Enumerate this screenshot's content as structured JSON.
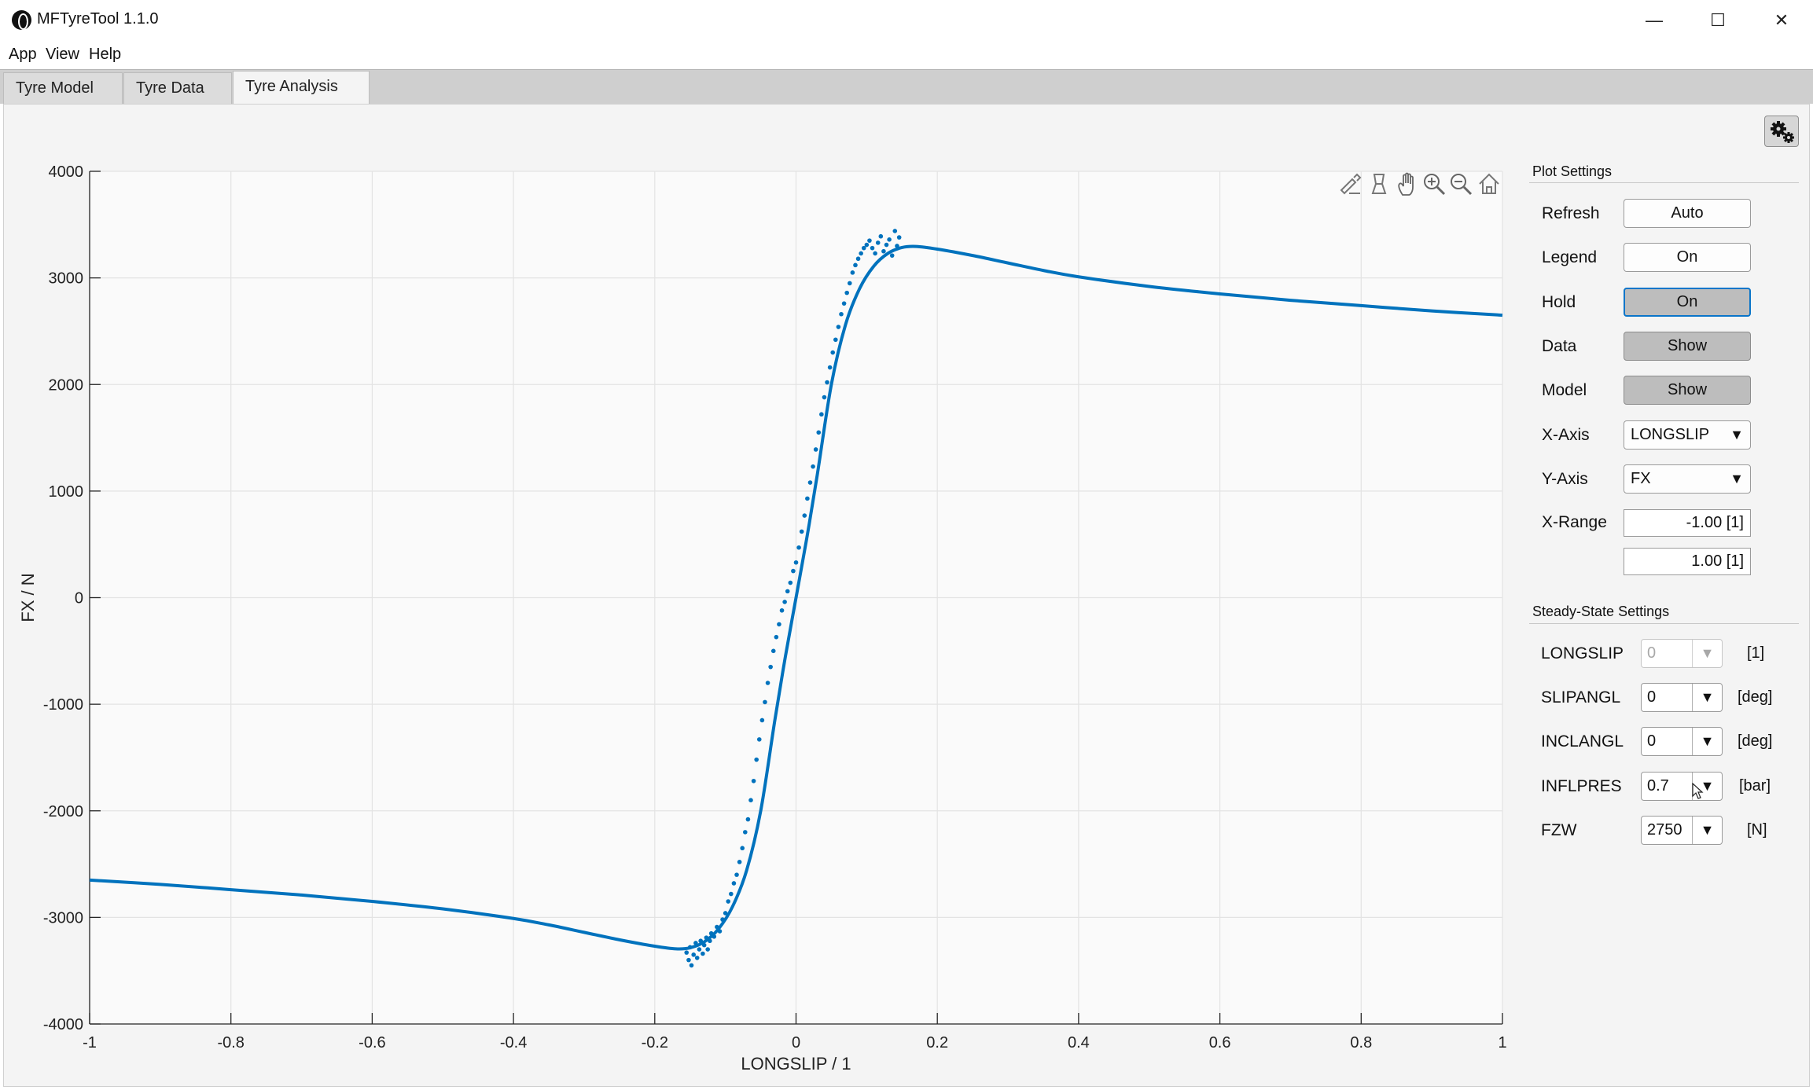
{
  "window": {
    "title": "MFTyreTool 1.1.0",
    "controls": {
      "minimize": "—",
      "maximize": "☐",
      "close": "✕"
    }
  },
  "menu": [
    "App",
    "View",
    "Help"
  ],
  "tabs": [
    {
      "label": "Tyre Model",
      "active": false
    },
    {
      "label": "Tyre Data",
      "active": false
    },
    {
      "label": "Tyre Analysis",
      "active": true
    }
  ],
  "plot_toolbar": [
    "brush-icon",
    "data-tips-icon",
    "pan-icon",
    "zoom-in-icon",
    "zoom-out-icon",
    "home-icon"
  ],
  "plot_settings": {
    "title": "Plot Settings",
    "refresh": {
      "label": "Refresh",
      "value": "Auto"
    },
    "legend": {
      "label": "Legend",
      "value": "On"
    },
    "hold": {
      "label": "Hold",
      "value": "On"
    },
    "data": {
      "label": "Data",
      "value": "Show"
    },
    "model": {
      "label": "Model",
      "value": "Show"
    },
    "x_axis": {
      "label": "X-Axis",
      "value": "LONGSLIP"
    },
    "y_axis": {
      "label": "Y-Axis",
      "value": "FX"
    },
    "x_range": {
      "label": "X-Range",
      "min": "-1.00 [1]",
      "max": "1.00 [1]"
    }
  },
  "steady_state": {
    "title": "Steady-State Settings",
    "rows": [
      {
        "label": "LONGSLIP",
        "value": "0",
        "unit": "[1]",
        "disabled": true
      },
      {
        "label": "SLIPANGL",
        "value": "0",
        "unit": "[deg]",
        "disabled": false
      },
      {
        "label": "INCLANGL",
        "value": "0",
        "unit": "[deg]",
        "disabled": false
      },
      {
        "label": "INFLPRES",
        "value": "0.7",
        "unit": "[bar]",
        "disabled": false
      },
      {
        "label": "FZW",
        "value": "2750",
        "unit": "[N]",
        "disabled": false
      }
    ]
  },
  "colors": {
    "series": "#0072bd",
    "grid": "#e3e3e3",
    "axes_bg": "#fafafa",
    "focus": "#0a75c9"
  },
  "chart_data": {
    "type": "line",
    "xlabel": "LONGSLIP / 1",
    "ylabel": "FX / N",
    "xlim": [
      -1,
      1
    ],
    "ylim": [
      -4000,
      4000
    ],
    "xticks": [
      -1,
      -0.8,
      -0.6,
      -0.4,
      -0.2,
      0,
      0.2,
      0.4,
      0.6,
      0.8,
      1
    ],
    "xtick_labels": [
      "-1",
      "-0.8",
      "-0.6",
      "-0.4",
      "-0.2",
      "0",
      "0.2",
      "0.4",
      "0.6",
      "0.8",
      "1"
    ],
    "yticks": [
      -4000,
      -3000,
      -2000,
      -1000,
      0,
      1000,
      2000,
      3000,
      4000
    ],
    "ytick_labels": [
      "-4000",
      "-3000",
      "-2000",
      "-1000",
      "0",
      "1000",
      "2000",
      "3000",
      "4000"
    ],
    "grid": true,
    "series": [
      {
        "kind": "line",
        "x": [
          -1,
          -0.9,
          -0.8,
          -0.7,
          -0.6,
          -0.5,
          -0.4,
          -0.35,
          -0.3,
          -0.25,
          -0.2,
          -0.17,
          -0.15,
          -0.13,
          -0.11,
          -0.09,
          -0.07,
          -0.05,
          -0.03,
          -0.015,
          0,
          0.015,
          0.03,
          0.05,
          0.07,
          0.09,
          0.11,
          0.13,
          0.15,
          0.17,
          0.2,
          0.25,
          0.3,
          0.35,
          0.4,
          0.5,
          0.6,
          0.7,
          0.8,
          0.9,
          1
        ],
        "y": [
          -2650,
          -2690,
          -2740,
          -2790,
          -2850,
          -2920,
          -3010,
          -3070,
          -3140,
          -3210,
          -3270,
          -3295,
          -3285,
          -3230,
          -3110,
          -2900,
          -2560,
          -2000,
          -1150,
          -550,
          0,
          550,
          1150,
          2000,
          2560,
          2900,
          3110,
          3230,
          3285,
          3295,
          3270,
          3210,
          3140,
          3070,
          3010,
          2920,
          2850,
          2790,
          2740,
          2690,
          2650
        ]
      },
      {
        "kind": "scatter",
        "x": [
          -0.155,
          -0.152,
          -0.15,
          -0.148,
          -0.145,
          -0.142,
          -0.14,
          -0.137,
          -0.135,
          -0.132,
          -0.13,
          -0.127,
          -0.125,
          -0.122,
          -0.12,
          -0.116,
          -0.112,
          -0.108,
          -0.104,
          -0.1,
          -0.096,
          -0.092,
          -0.088,
          -0.084,
          -0.08,
          -0.076,
          -0.072,
          -0.068,
          -0.064,
          -0.06,
          -0.056,
          -0.052,
          -0.048,
          -0.044,
          -0.04,
          -0.036,
          -0.032,
          -0.028,
          -0.024,
          -0.02,
          -0.016,
          -0.012,
          -0.008,
          -0.004,
          0,
          0.004,
          0.008,
          0.012,
          0.016,
          0.02,
          0.024,
          0.028,
          0.032,
          0.036,
          0.04,
          0.044,
          0.048,
          0.052,
          0.056,
          0.06,
          0.064,
          0.068,
          0.072,
          0.076,
          0.08,
          0.084,
          0.088,
          0.092,
          0.096,
          0.1,
          0.104,
          0.108,
          0.112,
          0.116,
          0.12,
          0.124,
          0.128,
          0.132,
          0.136,
          0.14,
          0.143,
          0.146
        ],
        "y": [
          -3330,
          -3400,
          -3280,
          -3450,
          -3350,
          -3240,
          -3380,
          -3300,
          -3220,
          -3340,
          -3260,
          -3190,
          -3300,
          -3220,
          -3150,
          -3180,
          -3090,
          -3130,
          -3020,
          -2960,
          -2850,
          -2780,
          -2680,
          -2600,
          -2480,
          -2350,
          -2200,
          -2080,
          -1900,
          -1720,
          -1520,
          -1330,
          -1150,
          -980,
          -800,
          -650,
          -500,
          -370,
          -250,
          -120,
          -40,
          60,
          140,
          250,
          330,
          470,
          620,
          770,
          930,
          1080,
          1230,
          1390,
          1550,
          1720,
          1880,
          2020,
          2160,
          2300,
          2420,
          2540,
          2660,
          2760,
          2860,
          2950,
          3050,
          3120,
          3180,
          3230,
          3280,
          3310,
          3350,
          3280,
          3230,
          3330,
          3390,
          3250,
          3310,
          3360,
          3210,
          3440,
          3300,
          3380
        ]
      }
    ]
  }
}
